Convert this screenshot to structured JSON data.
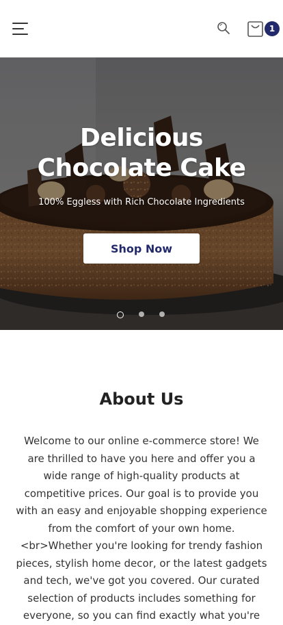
{
  "header": {
    "menu_icon": "hamburger-menu-icon",
    "search_icon": "search-icon",
    "cart_icon": "shopping-bag-icon",
    "cart_count": "1",
    "badge_color": "#232a6b"
  },
  "hero": {
    "title_line1": "Delicious",
    "title_line2": "Chocolate Cake",
    "subtitle": "100% Eggless with Rich Chocolate Ingredients",
    "button_label": "Shop Now",
    "slides_total": 3,
    "slide_active": 1
  },
  "about": {
    "title": "About Us",
    "body": "Welcome to our online e-commerce store! We are thrilled to have you here and offer you a wide range of high-quality products at competitive prices. Our goal is to provide you with an easy and enjoyable shopping experience from the comfort of your own home. <br>Whether you're looking for trendy fashion pieces, stylish home decor, or the latest gadgets and tech, we've got you covered. Our curated selection of products includes something for everyone, so you can find exactly what you're"
  }
}
